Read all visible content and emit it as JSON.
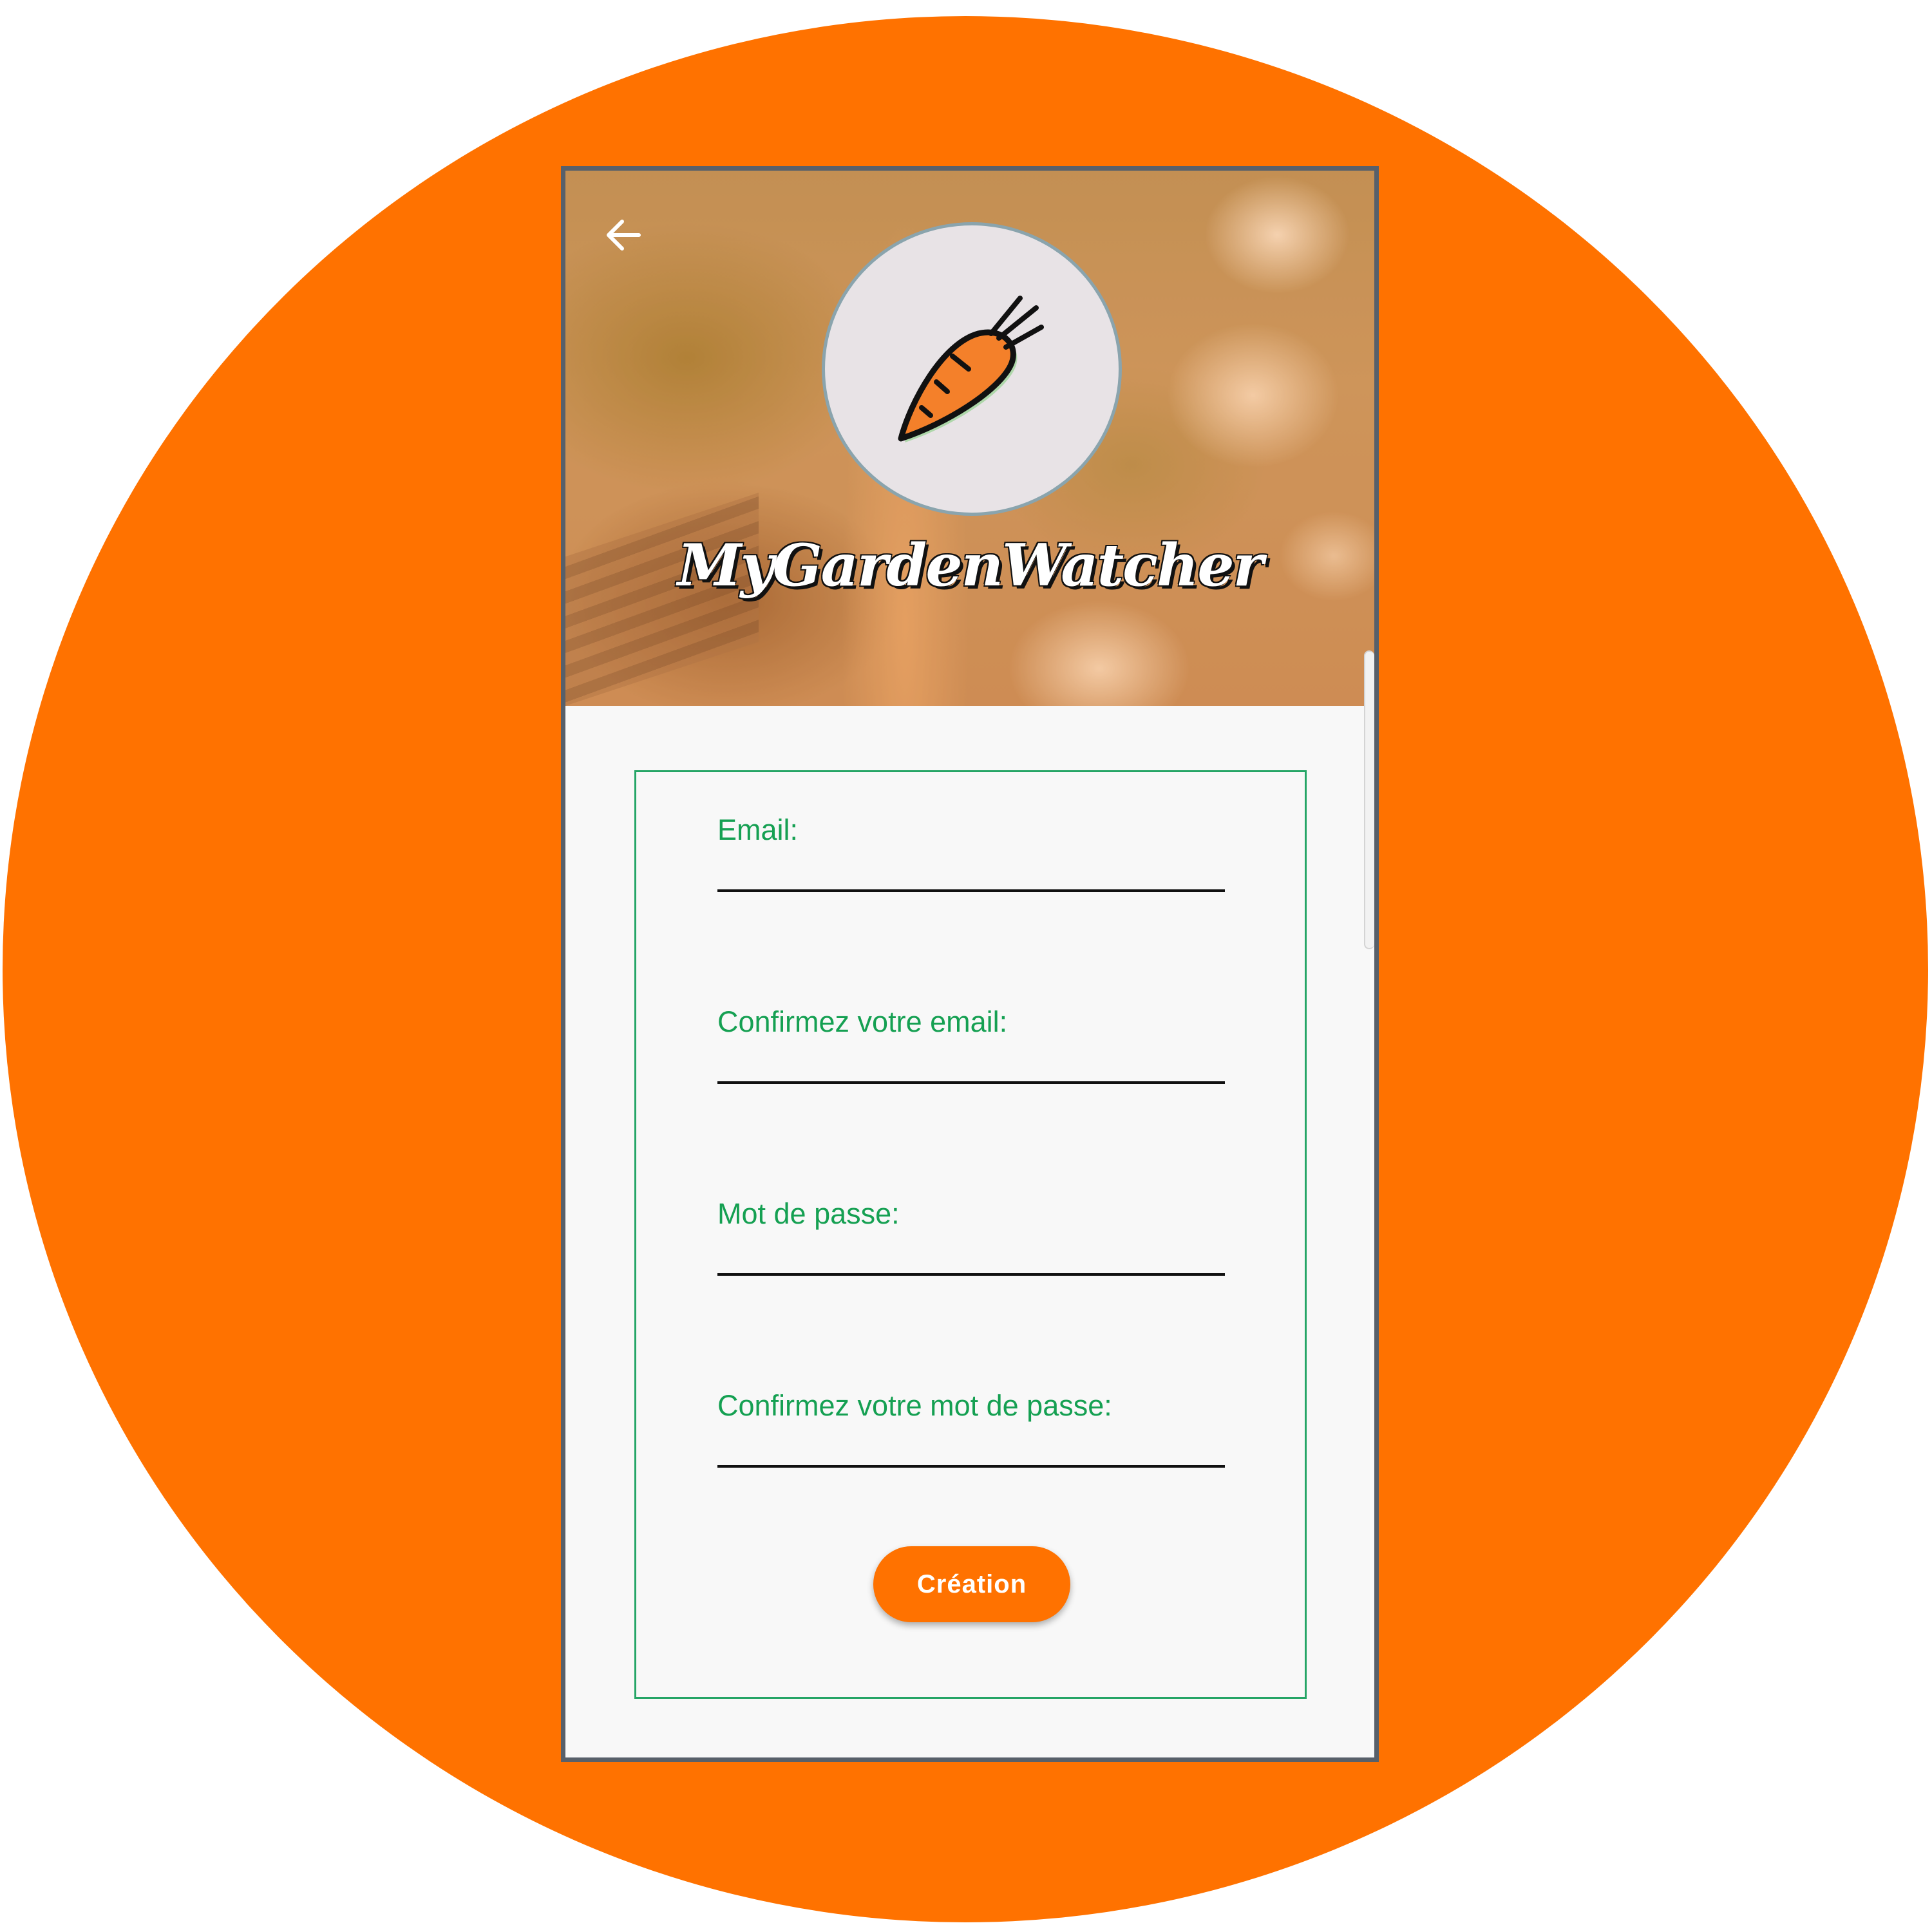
{
  "app": {
    "title": "MyGardenWatcher",
    "logo_icon": "carrot-icon"
  },
  "header": {
    "back_icon": "arrow-left-icon"
  },
  "form": {
    "fields": [
      {
        "label": "Email:",
        "value": "",
        "type": "email"
      },
      {
        "label": "Confirmez votre email:",
        "value": "",
        "type": "email"
      },
      {
        "label": "Mot de passe:",
        "value": "",
        "type": "password"
      },
      {
        "label": "Confirmez votre mot de passe:",
        "value": "",
        "type": "password"
      }
    ],
    "submit_label": "Création"
  },
  "colors": {
    "accent": "#FF7200",
    "label_green": "#15A052",
    "form_border": "#25A566",
    "frame_border": "#58606A",
    "logo_background": "#E8E3E6"
  }
}
